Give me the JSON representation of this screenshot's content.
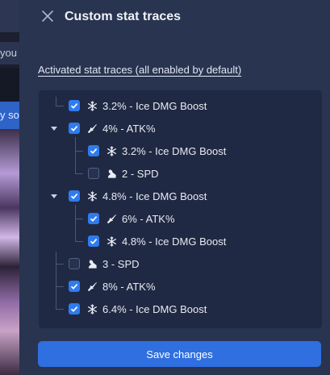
{
  "background": {
    "partial_text_1": "you",
    "partial_text_2": "y so"
  },
  "drawer": {
    "title": "Custom stat traces",
    "close_icon": "close-icon"
  },
  "section": {
    "label": "Activated stat traces (all enabled by default)"
  },
  "tree": [
    {
      "label": "3.2% - Ice DMG Boost",
      "checked": true,
      "icon": "ice-icon"
    },
    {
      "label": "4% - ATK%",
      "checked": true,
      "icon": "atk-icon",
      "expanded": true
    },
    {
      "label": "3.2% - Ice DMG Boost",
      "checked": true,
      "icon": "ice-icon"
    },
    {
      "label": "2 - SPD",
      "checked": false,
      "icon": "spd-icon"
    },
    {
      "label": "4.8% - Ice DMG Boost",
      "checked": true,
      "icon": "ice-icon",
      "expanded": true
    },
    {
      "label": "6% - ATK%",
      "checked": true,
      "icon": "atk-icon"
    },
    {
      "label": "4.8% - Ice DMG Boost",
      "checked": true,
      "icon": "ice-icon"
    },
    {
      "label": "3 - SPD",
      "checked": false,
      "icon": "spd-icon"
    },
    {
      "label": "8% - ATK%",
      "checked": true,
      "icon": "atk-icon"
    },
    {
      "label": "6.4% - Ice DMG Boost",
      "checked": true,
      "icon": "ice-icon"
    }
  ],
  "actions": {
    "save_label": "Save changes"
  },
  "colors": {
    "panel": "#283450",
    "tree_box": "#202943",
    "checkbox_on": "#2f7bf0",
    "save_button": "#2f6fe0"
  }
}
